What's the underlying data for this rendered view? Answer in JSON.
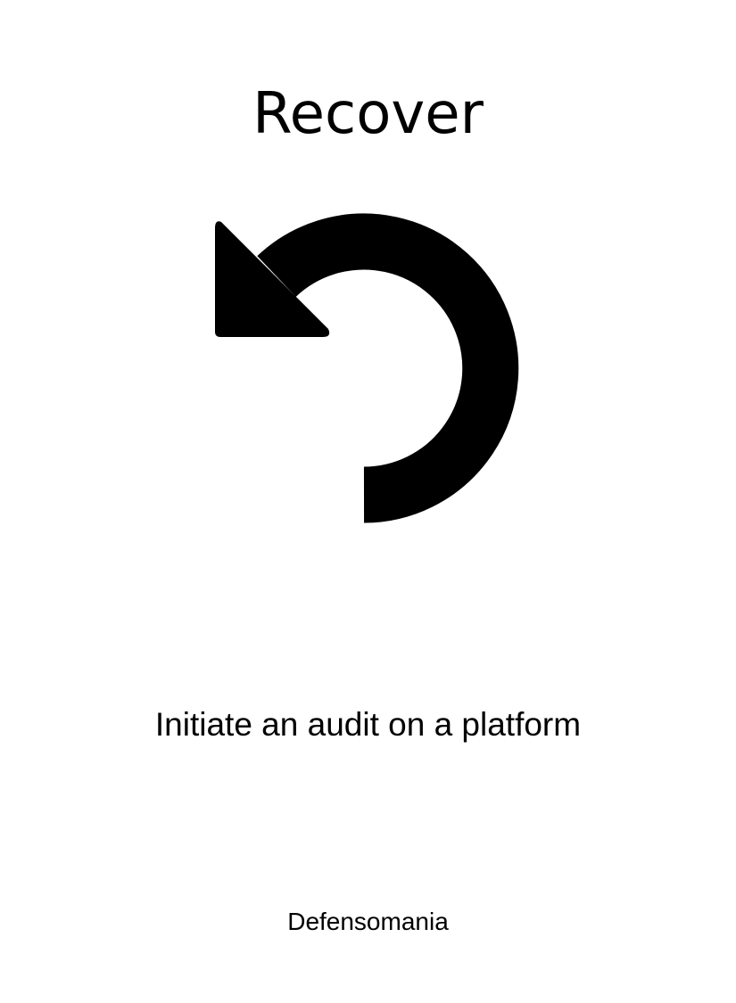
{
  "card": {
    "title": "Recover",
    "icon": "undo-arrow-icon",
    "description": "Initiate an audit on a platform",
    "brand": "Defensomania"
  },
  "colors": {
    "background": "#ffffff",
    "ink": "#000000"
  }
}
